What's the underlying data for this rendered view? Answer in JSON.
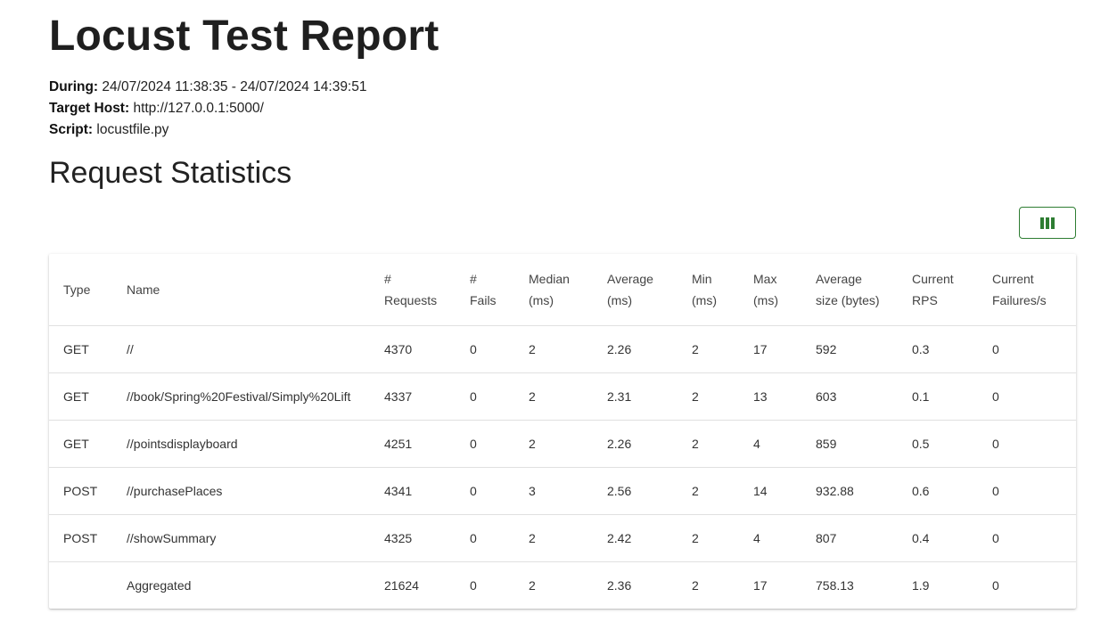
{
  "report": {
    "title": "Locust Test Report",
    "during_label": "During:",
    "during_value": "24/07/2024 11:38:35 - 24/07/2024 14:39:51",
    "host_label": "Target Host:",
    "host_value": "http://127.0.0.1:5000/",
    "script_label": "Script:",
    "script_value": "locustfile.py"
  },
  "stats": {
    "section_title": "Request Statistics",
    "columns_button_icon": "view-column-icon",
    "accent_color": "#2e7d32",
    "headers": [
      [
        "Type"
      ],
      [
        "Name"
      ],
      [
        "#",
        "Requests"
      ],
      [
        "#",
        "Fails"
      ],
      [
        "Median",
        "(ms)"
      ],
      [
        "Average",
        "(ms)"
      ],
      [
        "Min",
        "(ms)"
      ],
      [
        "Max",
        "(ms)"
      ],
      [
        "Average",
        "size (bytes)"
      ],
      [
        "Current",
        "RPS"
      ],
      [
        "Current",
        "Failures/s"
      ]
    ],
    "rows": [
      [
        "GET",
        "//",
        "4370",
        "0",
        "2",
        "2.26",
        "2",
        "17",
        "592",
        "0.3",
        "0"
      ],
      [
        "GET",
        "//book/Spring%20Festival/Simply%20Lift",
        "4337",
        "0",
        "2",
        "2.31",
        "2",
        "13",
        "603",
        "0.1",
        "0"
      ],
      [
        "GET",
        "//pointsdisplayboard",
        "4251",
        "0",
        "2",
        "2.26",
        "2",
        "4",
        "859",
        "0.5",
        "0"
      ],
      [
        "POST",
        "//purchasePlaces",
        "4341",
        "0",
        "3",
        "2.56",
        "2",
        "14",
        "932.88",
        "0.6",
        "0"
      ],
      [
        "POST",
        "//showSummary",
        "4325",
        "0",
        "2",
        "2.42",
        "2",
        "4",
        "807",
        "0.4",
        "0"
      ],
      [
        "",
        "Aggregated",
        "21624",
        "0",
        "2",
        "2.36",
        "2",
        "17",
        "758.13",
        "1.9",
        "0"
      ]
    ]
  }
}
